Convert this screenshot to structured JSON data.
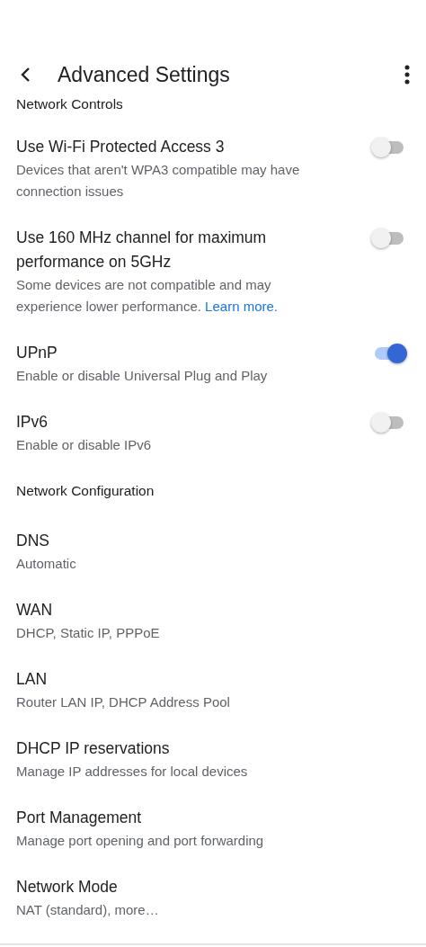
{
  "app_bar": {
    "title": "Advanced Settings"
  },
  "sections": [
    {
      "header": "Network Controls",
      "items": [
        {
          "kind": "toggle",
          "title": "Use Wi-Fi Protected Access 3",
          "subtitle": "Devices that aren't WPA3 compatible may have connection issues",
          "on": false
        },
        {
          "kind": "toggle",
          "title": "Use 160 MHz channel for maximum performance on 5GHz",
          "subtitle": "Some devices are not compatible and may experience lower performance.",
          "link": "Learn more.",
          "on": false
        },
        {
          "kind": "toggle",
          "title": "UPnP",
          "subtitle": "Enable or disable Universal Plug and Play",
          "on": true
        },
        {
          "kind": "toggle",
          "title": "IPv6",
          "subtitle": "Enable or disable IPv6",
          "on": false
        }
      ]
    },
    {
      "header": "Network Configuration",
      "items": [
        {
          "kind": "nav",
          "title": "DNS",
          "subtitle": "Automatic"
        },
        {
          "kind": "nav",
          "title": "WAN",
          "subtitle": "DHCP, Static IP, PPPoE"
        },
        {
          "kind": "nav",
          "title": "LAN",
          "subtitle": "Router LAN IP, DHCP Address Pool"
        },
        {
          "kind": "nav",
          "title": "DHCP IP reservations",
          "subtitle": "Manage IP addresses for local devices"
        },
        {
          "kind": "nav",
          "title": "Port Management",
          "subtitle": "Manage port opening and port forwarding"
        },
        {
          "kind": "nav",
          "title": "Network Mode",
          "subtitle": "NAT (standard), more…"
        }
      ]
    }
  ]
}
